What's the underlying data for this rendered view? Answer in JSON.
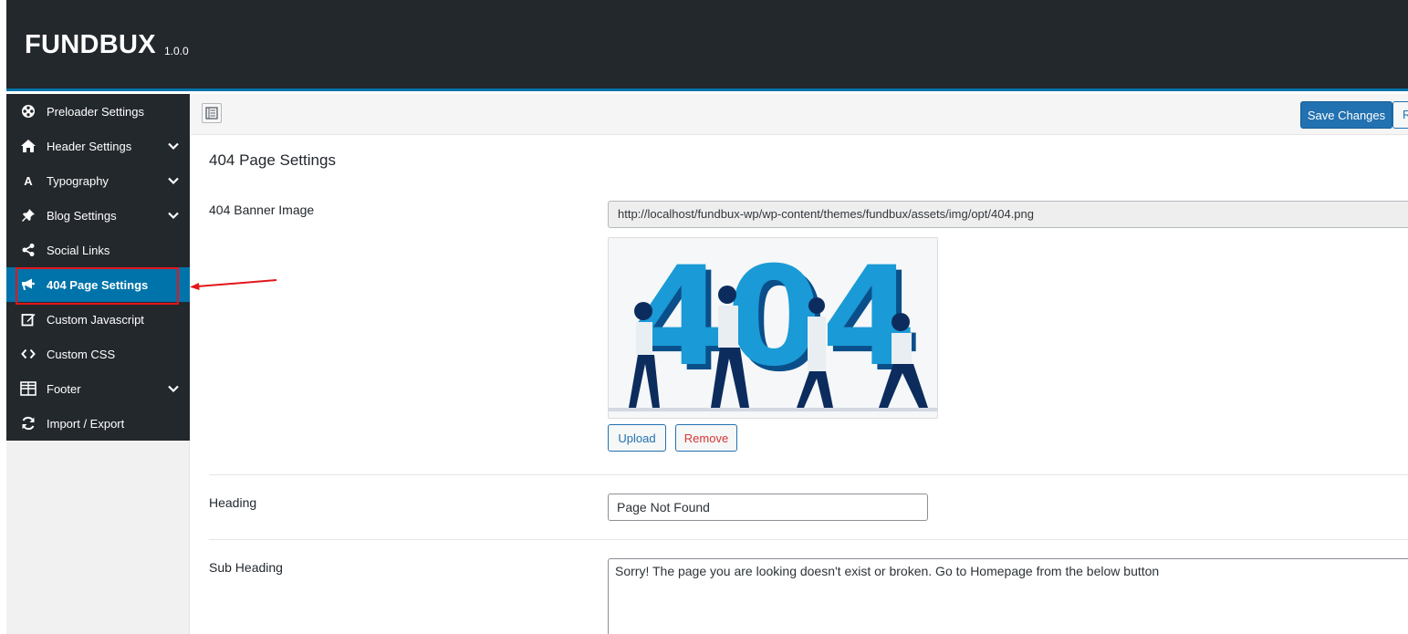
{
  "app": {
    "name": "FUNDBUX",
    "version": "1.0.0"
  },
  "sidebar": {
    "items": [
      {
        "label": "Preloader Settings",
        "icon": "preloader-icon",
        "expandable": false,
        "active": false
      },
      {
        "label": "Header Settings",
        "icon": "home-icon",
        "expandable": true,
        "active": false
      },
      {
        "label": "Typography",
        "icon": "typography-icon",
        "expandable": true,
        "active": false
      },
      {
        "label": "Blog Settings",
        "icon": "pin-icon",
        "expandable": true,
        "active": false
      },
      {
        "label": "Social Links",
        "icon": "share-icon",
        "expandable": false,
        "active": false
      },
      {
        "label": "404 Page Settings",
        "icon": "megaphone-icon",
        "expandable": false,
        "active": true
      },
      {
        "label": "Custom Javascript",
        "icon": "edit-icon",
        "expandable": false,
        "active": false
      },
      {
        "label": "Custom CSS",
        "icon": "code-icon",
        "expandable": false,
        "active": false
      },
      {
        "label": "Footer",
        "icon": "layout-icon",
        "expandable": true,
        "active": false
      },
      {
        "label": "Import / Export",
        "icon": "refresh-icon",
        "expandable": false,
        "active": false
      }
    ]
  },
  "toolbar": {
    "save_label": "Save Changes",
    "reset_label": "R"
  },
  "section": {
    "title": "404 Page Settings"
  },
  "fields": {
    "banner": {
      "label": "404 Banner Image",
      "url": "http://localhost/fundbux-wp/wp-content/themes/fundbux/assets/img/opt/404.png",
      "image_text": "404",
      "upload_label": "Upload",
      "remove_label": "Remove"
    },
    "heading": {
      "label": "Heading",
      "value": "Page Not Found"
    },
    "sub_heading": {
      "label": "Sub Heading",
      "value": "Sorry! The page you are looking doesn't exist or broken. Go to Homepage from the below button"
    }
  },
  "colors": {
    "header_bg": "#23282d",
    "accent": "#0073aa",
    "primary_button": "#2271b1",
    "remove_text": "#d63638",
    "highlight_box": "#e3161b"
  }
}
